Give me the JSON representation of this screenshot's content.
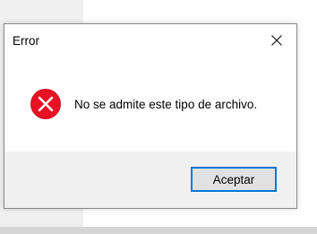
{
  "dialog": {
    "title": "Error",
    "message": "No se admite este tipo de archivo.",
    "ok_label": "Aceptar",
    "close_icon": "close-icon",
    "message_icon": "error-icon"
  },
  "colors": {
    "error_red": "#e81123",
    "accent_blue": "#0078d7",
    "footer_bg": "#f0f0f0"
  }
}
